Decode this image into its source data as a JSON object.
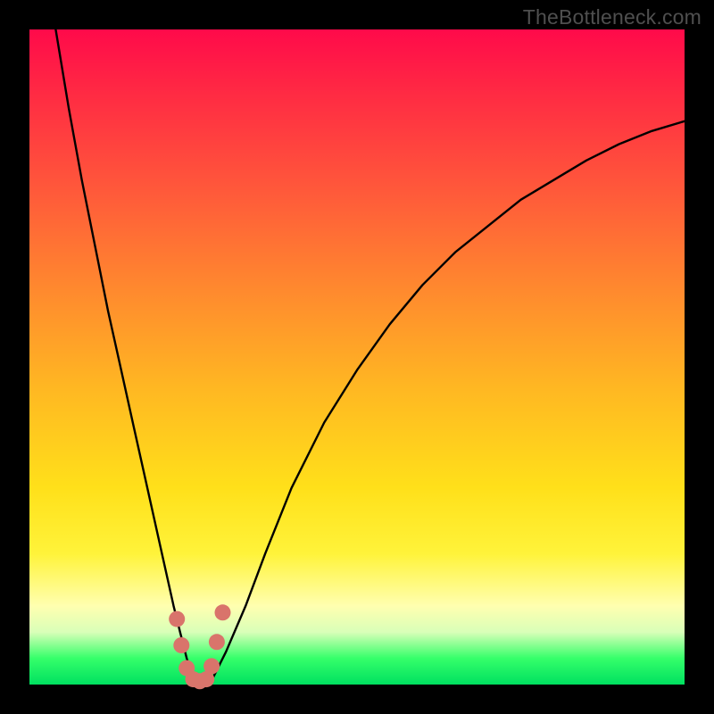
{
  "watermark": "TheBottleneck.com",
  "chart_data": {
    "type": "line",
    "title": "",
    "xlabel": "",
    "ylabel": "",
    "xlim": [
      0,
      100
    ],
    "ylim": [
      0,
      100
    ],
    "series": [
      {
        "name": "bottleneck-curve",
        "x": [
          4,
          6,
          8,
          10,
          12,
          14,
          16,
          18,
          20,
          22,
          23,
          24,
          25,
          26,
          27,
          28,
          30,
          33,
          36,
          40,
          45,
          50,
          55,
          60,
          65,
          70,
          75,
          80,
          85,
          90,
          95,
          100
        ],
        "values": [
          100,
          88,
          77,
          67,
          57,
          48,
          39,
          30,
          21,
          12,
          8,
          4,
          1,
          0,
          0,
          1,
          5,
          12,
          20,
          30,
          40,
          48,
          55,
          61,
          66,
          70,
          74,
          77,
          80,
          82.5,
          84.5,
          86
        ]
      }
    ],
    "markers": {
      "name": "highlight-dots",
      "color": "#d9746b",
      "points": [
        {
          "x": 22.5,
          "y": 10
        },
        {
          "x": 23.2,
          "y": 6
        },
        {
          "x": 24.0,
          "y": 2.5
        },
        {
          "x": 25.0,
          "y": 0.8
        },
        {
          "x": 26.0,
          "y": 0.5
        },
        {
          "x": 27.0,
          "y": 0.8
        },
        {
          "x": 27.8,
          "y": 2.8
        },
        {
          "x": 28.6,
          "y": 6.5
        },
        {
          "x": 29.5,
          "y": 11
        }
      ]
    },
    "gradient_stops": [
      {
        "pos": 0,
        "color": "#ff0a4a"
      },
      {
        "pos": 10,
        "color": "#ff2b43"
      },
      {
        "pos": 25,
        "color": "#ff5a3a"
      },
      {
        "pos": 40,
        "color": "#ff8a2e"
      },
      {
        "pos": 55,
        "color": "#ffb822"
      },
      {
        "pos": 70,
        "color": "#ffe01a"
      },
      {
        "pos": 80,
        "color": "#fff33a"
      },
      {
        "pos": 88,
        "color": "#ffffb0"
      },
      {
        "pos": 92,
        "color": "#d9ffb8"
      },
      {
        "pos": 96,
        "color": "#35ff6a"
      },
      {
        "pos": 100,
        "color": "#00e060"
      }
    ]
  }
}
